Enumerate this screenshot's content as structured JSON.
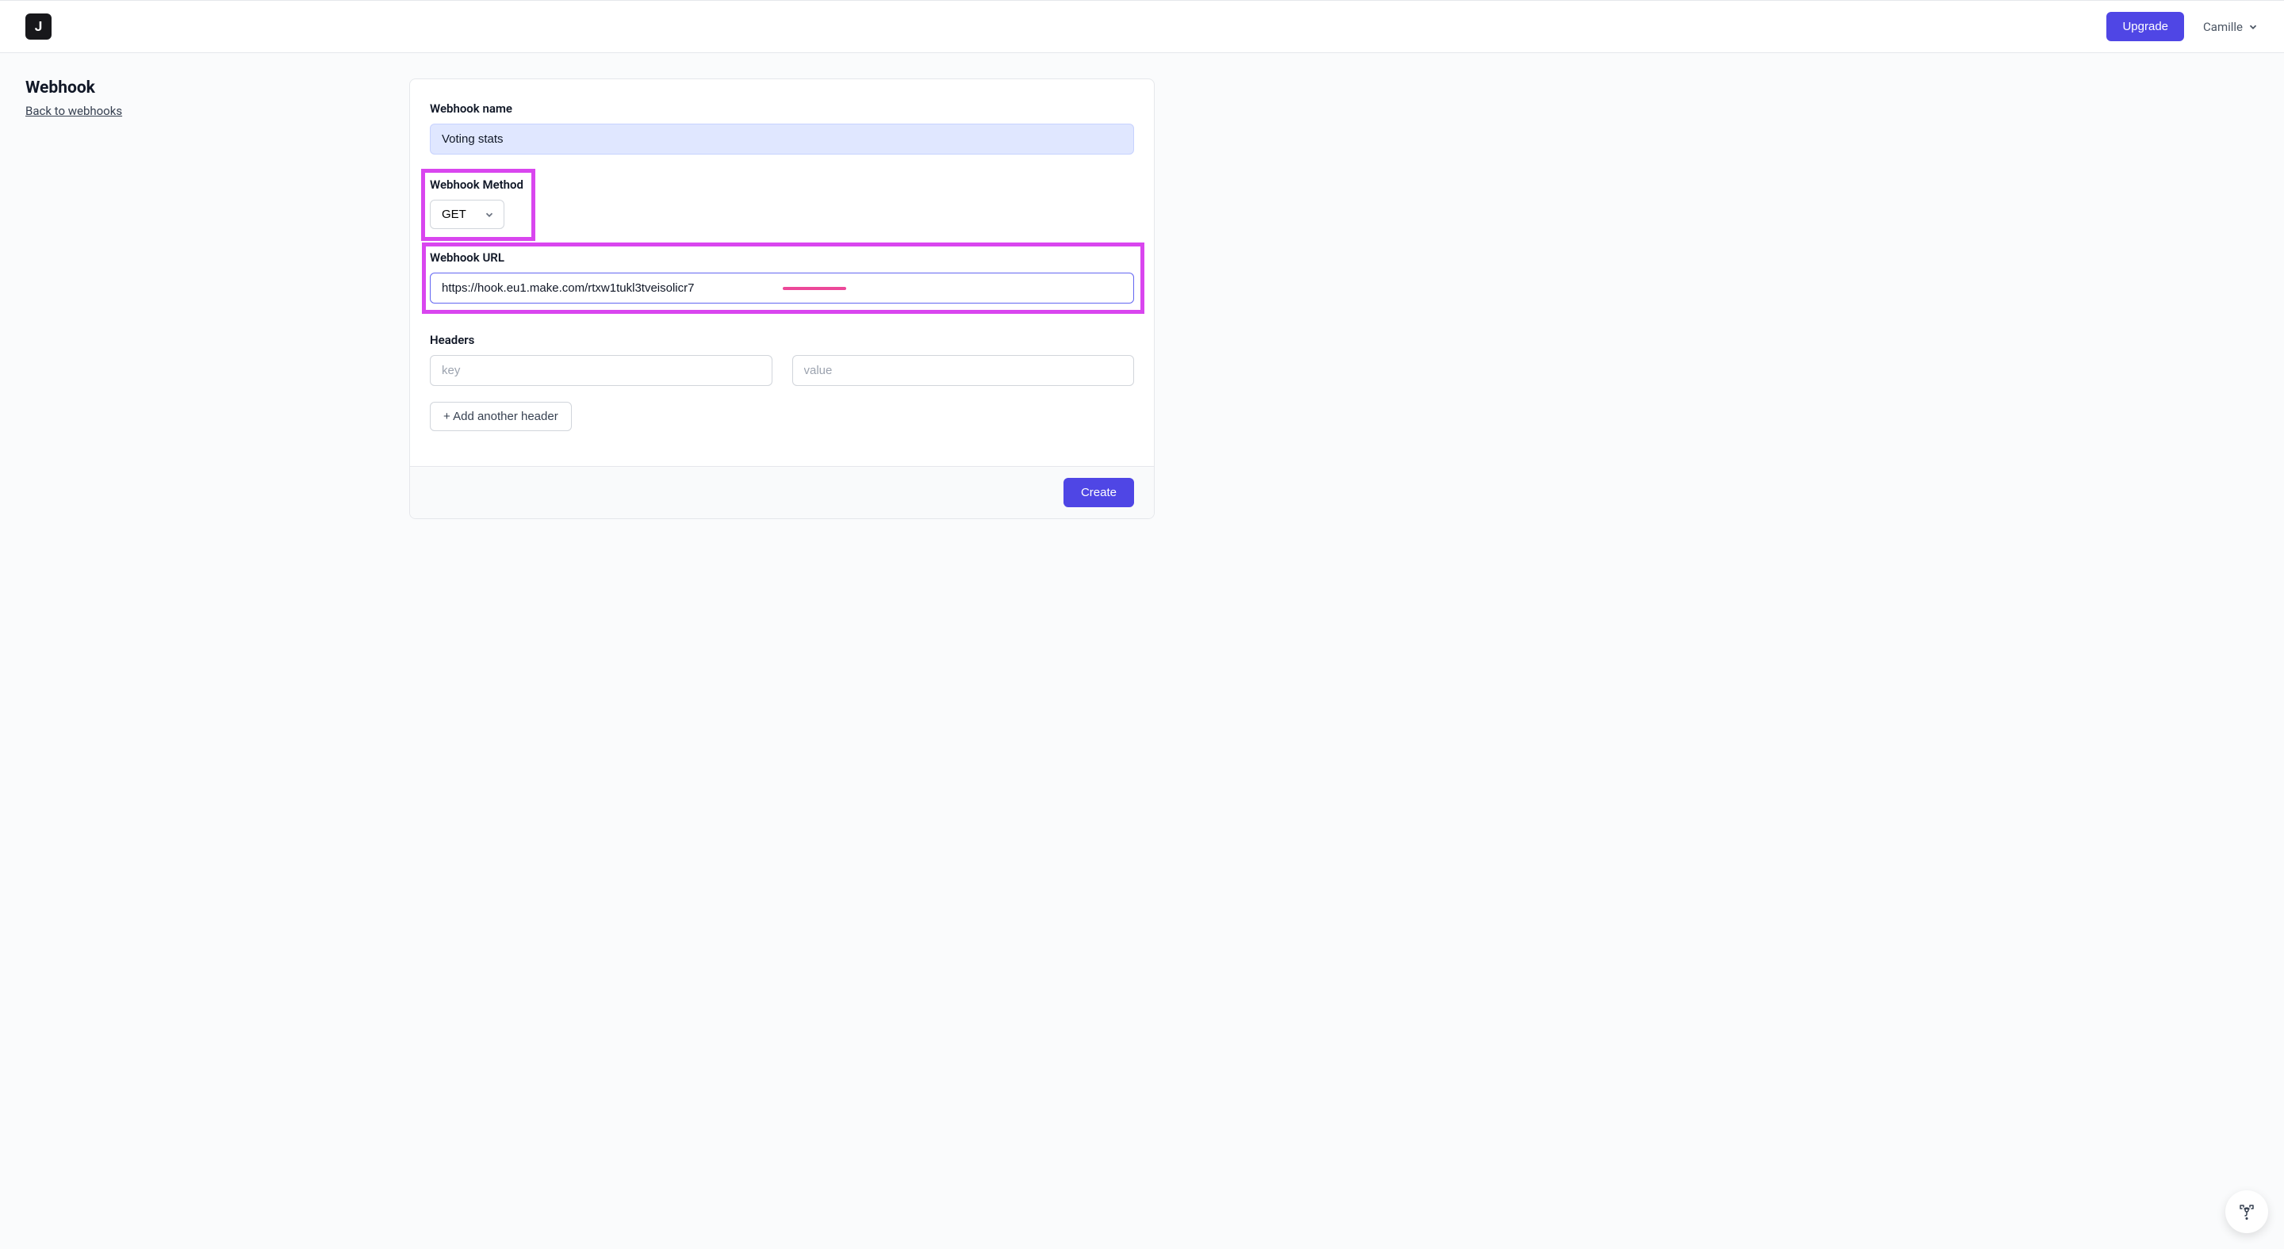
{
  "header": {
    "logo_letter": "J",
    "upgrade_label": "Upgrade",
    "user_name": "Camille"
  },
  "sidebar": {
    "title": "Webhook",
    "back_link": "Back to webhooks"
  },
  "form": {
    "name": {
      "label": "Webhook name",
      "value": "Voting stats"
    },
    "method": {
      "label": "Webhook Method",
      "value": "GET"
    },
    "url": {
      "label": "Webhook URL",
      "value": "https://hook.eu1.make.com/rtxw1tukl3tveisolicr7"
    },
    "headers": {
      "label": "Headers",
      "key_placeholder": "key",
      "value_placeholder": "value",
      "add_button": "+ Add another header"
    },
    "submit": "Create"
  }
}
